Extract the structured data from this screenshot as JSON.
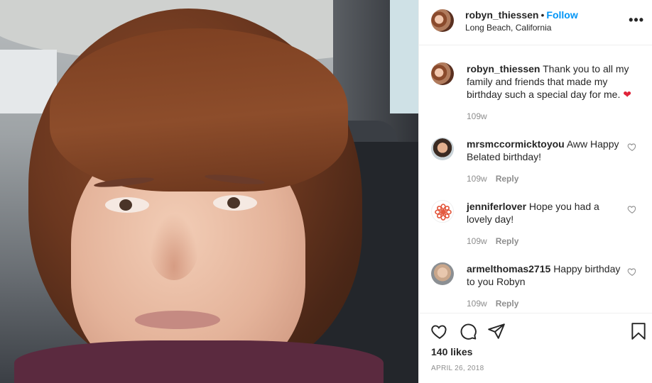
{
  "post": {
    "author": "robyn_thiessen",
    "separator": "•",
    "follow_label": "Follow",
    "location": "Long Beach, California",
    "more_label": "•••",
    "caption": {
      "username": "robyn_thiessen",
      "text": "Thank you to all my family and friends that made my birthday such a special day for me.",
      "emoji": "❤",
      "time": "109w"
    },
    "comments": [
      {
        "username": "mrsmccormicktoyou",
        "text": "Aww Happy Belated birthday!",
        "time": "109w",
        "reply_label": "Reply"
      },
      {
        "username": "jenniferlover",
        "text": "Hope you had a lovely day!",
        "time": "109w",
        "reply_label": "Reply"
      },
      {
        "username": "armelthomas2715",
        "text": "Happy birthday to you Robyn",
        "time": "109w",
        "reply_label": "Reply"
      }
    ],
    "likes": "140 likes",
    "date": "APRIL 26, 2018"
  },
  "icons": {
    "like": "heart-icon",
    "comment": "comment-icon",
    "share": "share-icon",
    "save": "bookmark-icon"
  },
  "colors": {
    "follow": "#0095f6",
    "meta": "#8e8e8e",
    "heart_emoji": "#e0243a"
  }
}
